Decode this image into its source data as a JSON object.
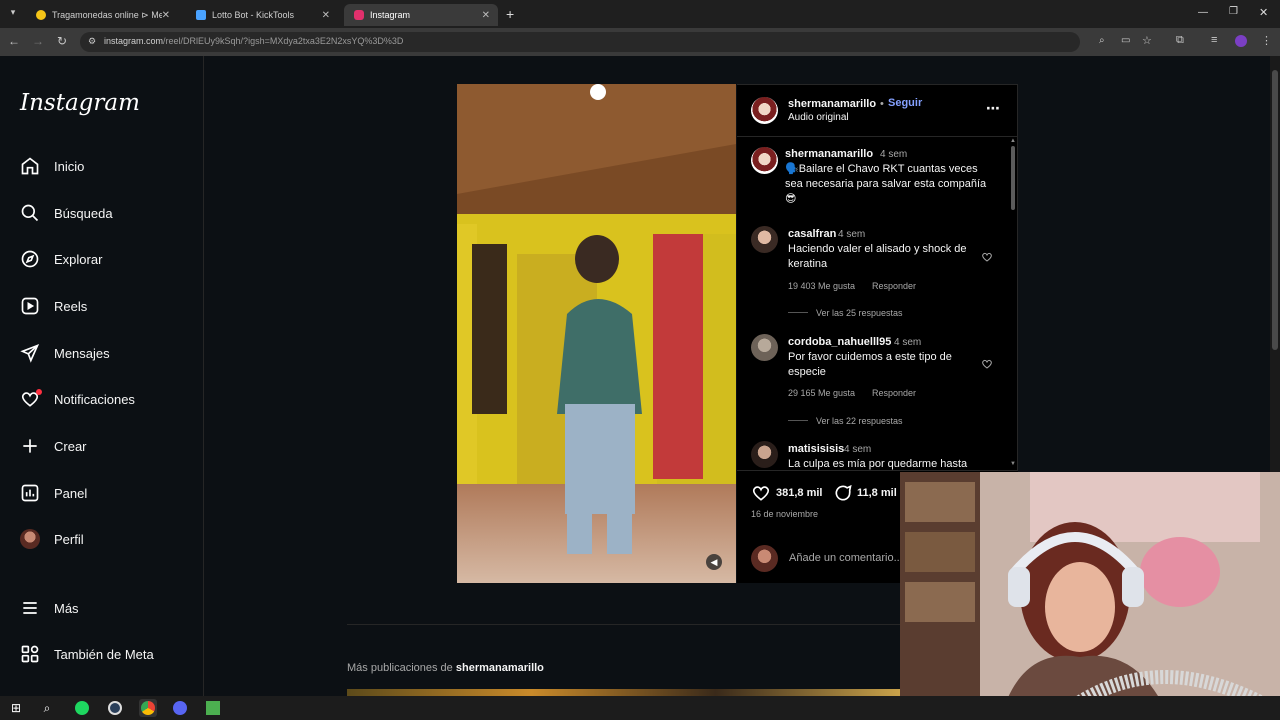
{
  "browser": {
    "tabs": [
      {
        "title": "Tragamonedas online ⊳ MelBet",
        "color": "#f5c518"
      },
      {
        "title": "Lotto Bot - KickTools",
        "color": "#4aa3ff"
      },
      {
        "title": "Instagram",
        "color": "#e1306c"
      }
    ],
    "new_tab": "+",
    "url_host": "instagram.com",
    "url_path": "/reel/DRlEUy9kSqh/?igsh=MXdya2txa3E2N2xsYQ%3D%3D"
  },
  "sidebar": {
    "logo": "Instagram",
    "items": [
      {
        "label": "Inicio",
        "icon": "home-icon"
      },
      {
        "label": "Búsqueda",
        "icon": "search-icon"
      },
      {
        "label": "Explorar",
        "icon": "compass-icon"
      },
      {
        "label": "Reels",
        "icon": "reels-icon"
      },
      {
        "label": "Mensajes",
        "icon": "send-icon"
      },
      {
        "label": "Notificaciones",
        "icon": "heart-icon"
      },
      {
        "label": "Crear",
        "icon": "plus-icon"
      },
      {
        "label": "Panel",
        "icon": "chart-icon"
      },
      {
        "label": "Perfil",
        "icon": "avatar"
      }
    ],
    "more": "Más",
    "meta": "También de Meta"
  },
  "post": {
    "author": "shermanamarillo",
    "follow": "Seguir",
    "separator": "•",
    "audio": "Audio original",
    "caption": {
      "user": "shermanamarillo",
      "time": "4 sem",
      "text": "🗣️Bailare el Chavo RKT cuantas veces sea necesaria para salvar esta compañía 😎"
    },
    "comments": [
      {
        "user": "casalfran",
        "time": "4 sem",
        "text": "Haciendo valer el alisado y shock de keratina",
        "likes": "19 403 Me gusta",
        "reply": "Responder",
        "replies": "Ver las 25 respuestas"
      },
      {
        "user": "cordoba_nahuelll95",
        "time": "4 sem",
        "text": "Por favor cuidemos a este tipo de especie",
        "likes": "29 165 Me gusta",
        "reply": "Responder",
        "replies": "Ver las 22 respuestas"
      },
      {
        "user": "matisisisis",
        "time": "4 sem",
        "text": "La culpa es mía por quedarme hasta"
      }
    ],
    "like_count": "381,8 mil",
    "comment_count": "11,8 mil",
    "date": "16 de noviembre",
    "add_comment_placeholder": "Añade un comentario..."
  },
  "more_posts": {
    "prefix": "Más publicaciones de",
    "user": "shermanamarillo"
  },
  "colors": {
    "accent_link": "#85a1ff",
    "background": "#0c1014",
    "notification_dot": "#ff3040"
  }
}
